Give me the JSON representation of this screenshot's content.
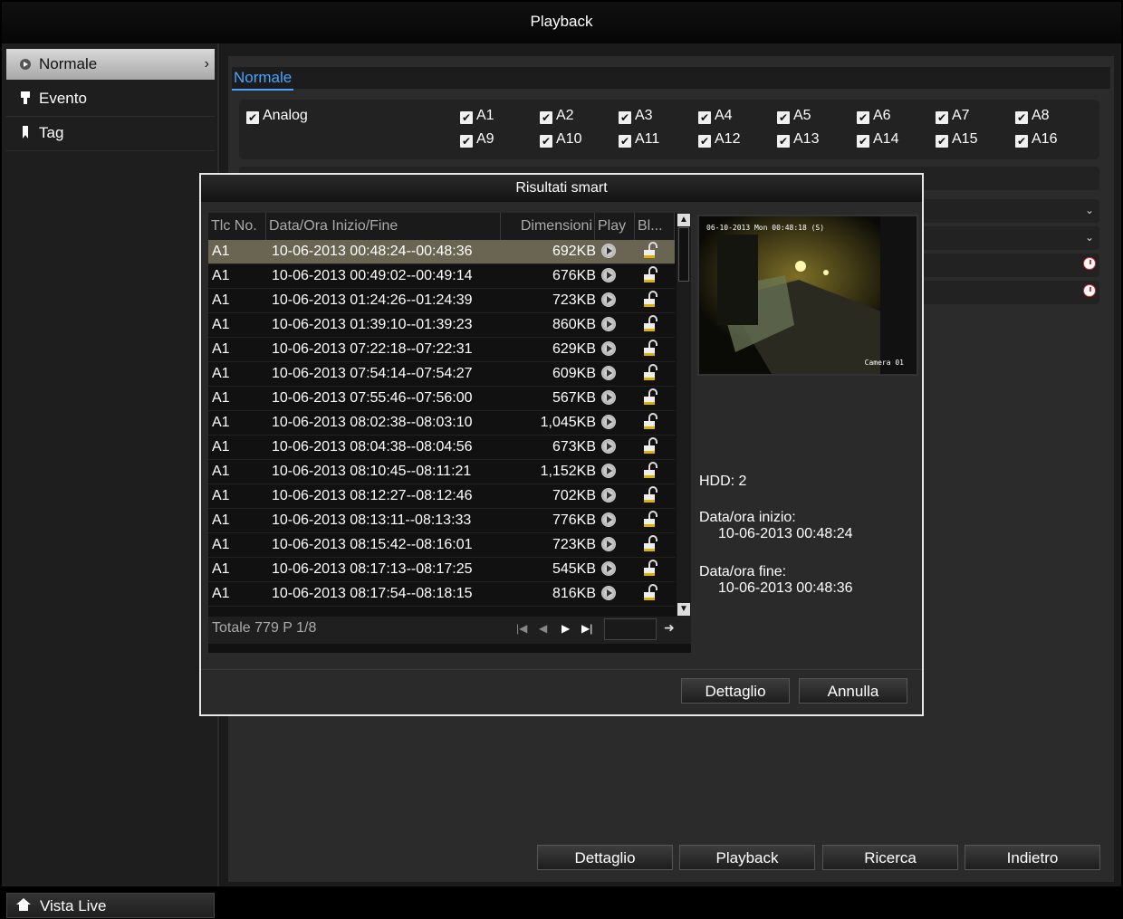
{
  "window": {
    "title": "Playback"
  },
  "sidebar": {
    "items": [
      {
        "label": "Normale",
        "icon": "play-circle-icon",
        "active": true
      },
      {
        "label": "Evento",
        "icon": "event-icon"
      },
      {
        "label": "Tag",
        "icon": "tag-icon"
      }
    ],
    "live_view": "Vista Live"
  },
  "main": {
    "tab": "Normale",
    "analog_label": "Analog",
    "channels": [
      "A1",
      "A2",
      "A3",
      "A4",
      "A5",
      "A6",
      "A7",
      "A8",
      "A9",
      "A10",
      "A11",
      "A12",
      "A13",
      "A14",
      "A15",
      "A16"
    ],
    "buttons": [
      "Dettaglio",
      "Playback",
      "Ricerca",
      "Indietro"
    ]
  },
  "dialog": {
    "title": "Risultati smart",
    "columns": [
      "Tlc No.",
      "Data/Ora Inizio/Fine",
      "Dimensioni",
      "Play",
      "Bl..."
    ],
    "rows": [
      {
        "ch": "A1",
        "time": "10-06-2013 00:48:24--00:48:36",
        "size": "692KB",
        "selected": true
      },
      {
        "ch": "A1",
        "time": "10-06-2013 00:49:02--00:49:14",
        "size": "676KB"
      },
      {
        "ch": "A1",
        "time": "10-06-2013 01:24:26--01:24:39",
        "size": "723KB"
      },
      {
        "ch": "A1",
        "time": "10-06-2013 01:39:10--01:39:23",
        "size": "860KB"
      },
      {
        "ch": "A1",
        "time": "10-06-2013 07:22:18--07:22:31",
        "size": "629KB"
      },
      {
        "ch": "A1",
        "time": "10-06-2013 07:54:14--07:54:27",
        "size": "609KB"
      },
      {
        "ch": "A1",
        "time": "10-06-2013 07:55:46--07:56:00",
        "size": "567KB"
      },
      {
        "ch": "A1",
        "time": "10-06-2013 08:02:38--08:03:10",
        "size": "1,045KB"
      },
      {
        "ch": "A1",
        "time": "10-06-2013 08:04:38--08:04:56",
        "size": "673KB"
      },
      {
        "ch": "A1",
        "time": "10-06-2013 08:10:45--08:11:21",
        "size": "1,152KB"
      },
      {
        "ch": "A1",
        "time": "10-06-2013 08:12:27--08:12:46",
        "size": "702KB"
      },
      {
        "ch": "A1",
        "time": "10-06-2013 08:13:11--08:13:33",
        "size": "776KB"
      },
      {
        "ch": "A1",
        "time": "10-06-2013 08:15:42--08:16:01",
        "size": "723KB"
      },
      {
        "ch": "A1",
        "time": "10-06-2013 08:17:13--08:17:25",
        "size": "545KB"
      },
      {
        "ch": "A1",
        "time": "10-06-2013 08:17:54--08:18:15",
        "size": "816KB"
      }
    ],
    "pager": {
      "text": "Totale 779 P 1/8",
      "page_input": ""
    },
    "preview": {
      "timestamp": "06-10-2013 Mon 00:48:18 (S)",
      "camera": "Camera 01"
    },
    "info": {
      "hdd": "HDD: 2",
      "start_label": "Data/ora inizio:",
      "start_value": "10-06-2013 00:48:24",
      "end_label": "Data/ora fine:",
      "end_value": "10-06-2013 00:48:36"
    },
    "buttons": {
      "detail": "Dettaglio",
      "cancel": "Annulla"
    }
  }
}
